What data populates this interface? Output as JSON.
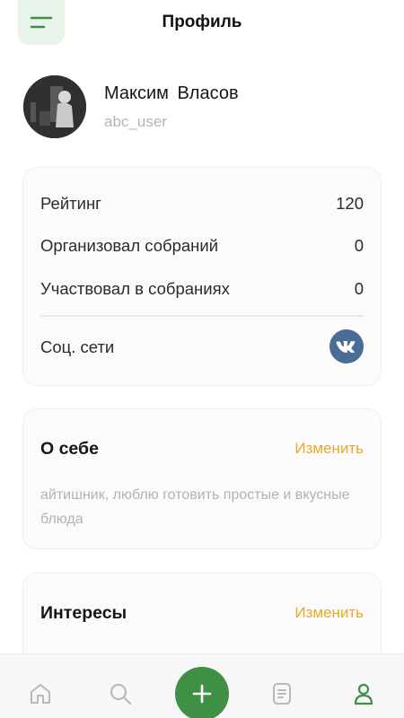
{
  "header": {
    "title": "Профиль",
    "menu_icon": "menu-icon"
  },
  "profile": {
    "name": "Максим  Власов",
    "username": "abc_user"
  },
  "stats": {
    "rows": [
      {
        "label": "Рейтинг",
        "value": "120"
      },
      {
        "label": "Организовал собраний",
        "value": "0"
      },
      {
        "label": "Участвовал в собраниях",
        "value": "0"
      }
    ],
    "social_label": "Соц. сети",
    "social_icon": "vk-icon"
  },
  "about": {
    "title": "О себе",
    "edit_label": "Изменить",
    "text": "айтишник, люблю готовить простые и вкусные блюда"
  },
  "interests": {
    "title": "Интересы",
    "edit_label": "Изменить"
  },
  "nav": {
    "items": [
      "home-icon",
      "search-icon",
      "add-icon",
      "list-icon",
      "profile-icon"
    ],
    "active": "profile-icon"
  },
  "colors": {
    "accent_green": "#3f8f45",
    "edit_orange": "#e9a92a",
    "vk_blue": "#4a6d98"
  }
}
